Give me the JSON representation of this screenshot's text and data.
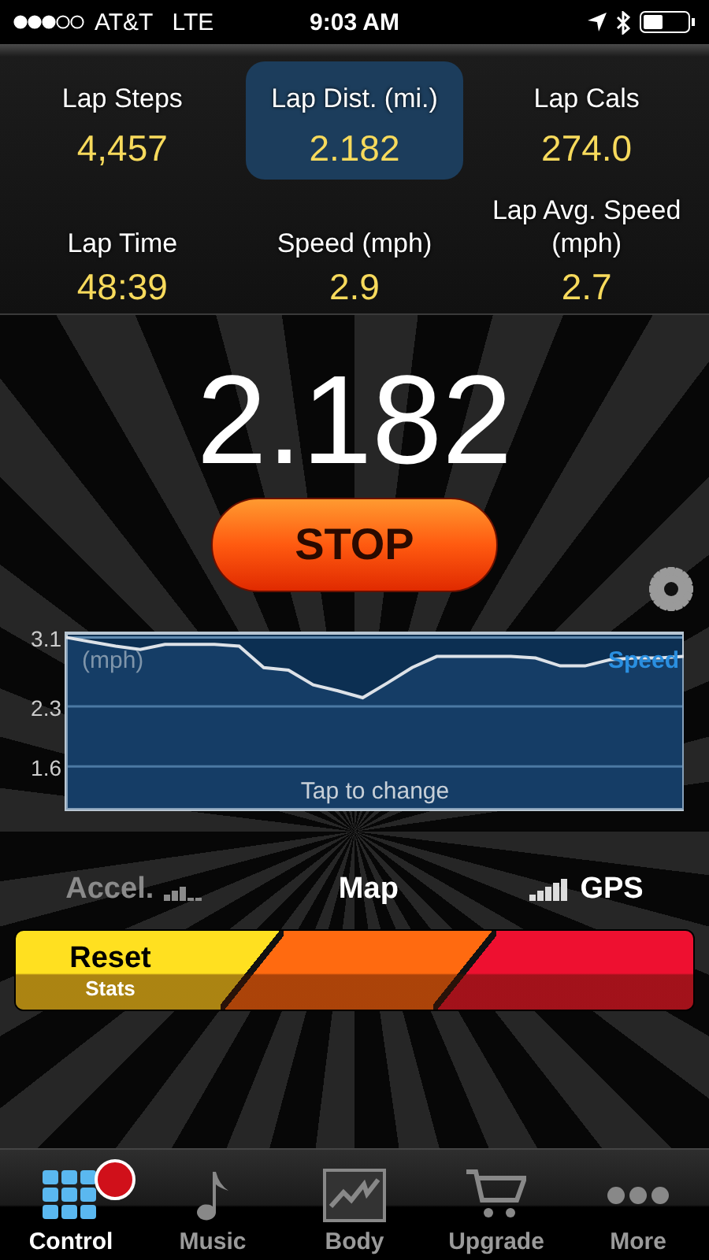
{
  "status_bar": {
    "carrier": "AT&T",
    "network": "LTE",
    "time": "9:03 AM"
  },
  "stats": [
    {
      "label": "Lap Steps",
      "value": "4,457",
      "selected": false
    },
    {
      "label": "Lap Dist. (mi.)",
      "value": "2.182",
      "selected": true
    },
    {
      "label": "Lap Cals",
      "value": "274.0",
      "selected": false
    },
    {
      "label": "Lap Time",
      "value": "48:39",
      "selected": false
    },
    {
      "label": "Speed (mph)",
      "value": "2.9",
      "selected": false
    },
    {
      "label": "Lap Avg. Speed (mph)",
      "value": "2.7",
      "selected": false
    }
  ],
  "distance_display": "2.182",
  "stop_button": "STOP",
  "speed_chart": {
    "unit": "(mph)",
    "hint": "Tap to change",
    "chart_data": {
      "type": "area",
      "ylim": [
        1.1,
        3.15
      ],
      "yticks": [
        1.6,
        2.3,
        3.1
      ],
      "grid": true,
      "series": [
        {
          "name": "Speed",
          "color": "#dde2e8",
          "values": [
            3.1,
            3.05,
            3.0,
            2.96,
            3.02,
            3.02,
            3.02,
            3.0,
            2.75,
            2.72,
            2.55,
            2.48,
            2.4,
            2.57,
            2.75,
            2.88,
            2.88,
            2.88,
            2.88,
            2.86,
            2.77,
            2.77,
            2.84,
            2.86,
            2.86,
            2.88
          ]
        }
      ]
    }
  },
  "sensors": [
    {
      "label": "Accel.",
      "kind": "accel",
      "disabled": true
    },
    {
      "label": "Map",
      "kind": "map",
      "disabled": false
    },
    {
      "label": "GPS",
      "kind": "gps",
      "disabled": false
    }
  ],
  "actions": [
    {
      "label": "Reset",
      "sublabel": "Stats",
      "color": "#ffe020"
    },
    {
      "color": "#ff6a10"
    },
    {
      "color": "#ee1030"
    }
  ],
  "tab_bar": [
    {
      "label": "Control",
      "kind": "grid",
      "selected": true,
      "badge": true
    },
    {
      "label": "Music",
      "kind": "note",
      "selected": false,
      "badge": false
    },
    {
      "label": "Body",
      "kind": "chart",
      "selected": false,
      "badge": false
    },
    {
      "label": "Upgrade",
      "kind": "cart",
      "selected": false,
      "badge": false
    },
    {
      "label": "More",
      "kind": "dots",
      "selected": false,
      "badge": false
    }
  ]
}
